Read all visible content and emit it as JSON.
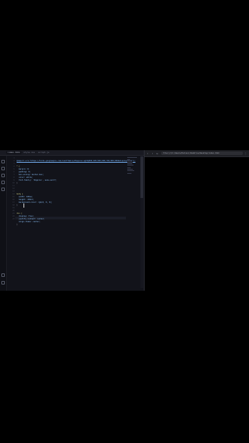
{
  "editor": {
    "tabs": [
      {
        "label": "index.html"
      },
      {
        "label": "style.css"
      },
      {
        "label": "script.js"
      }
    ],
    "line_numbers": [
      "1",
      "2",
      "3",
      "4",
      "5",
      "6",
      "7",
      "8",
      "9",
      "10",
      "11",
      "12",
      "13",
      "14",
      "15",
      "16",
      "17",
      "18",
      "19",
      "20",
      "21",
      "22",
      "23"
    ],
    "code": [
      "@import url(\"https://fonts.googleapis.com/css2?family=Poppins:wght@300;400;500;600;700;800;900&display=swap\");",
      "",
      "* {",
      "  margin: 0;",
      "  padding: 0;",
      "  box-sizing: border-box;",
      "  color: white;",
      "  font-family: 'Poppins', sans-serif;",
      "}",
      "",
      "body {",
      "  width: 100vw;",
      "  height: 100vh;",
      "  background-color: rgb(0, 0, 0);",
      "}",
      "",
      "div {",
      "  display: flex;",
      "  justify-content: center;",
      "  align-items: center;",
      "}",
      "",
      ""
    ]
  },
  "browser": {
    "address": "file:///C:/Users/Pallavi/OneDrive/Desktop/index.html",
    "back_icon": "arrow-left-icon",
    "forward_icon": "arrow-right-icon",
    "reload_icon": "reload-icon",
    "menu_icon": "more-icon"
  },
  "colors": {
    "editor_bg": "#12131a",
    "browser_bg": "#000000"
  }
}
